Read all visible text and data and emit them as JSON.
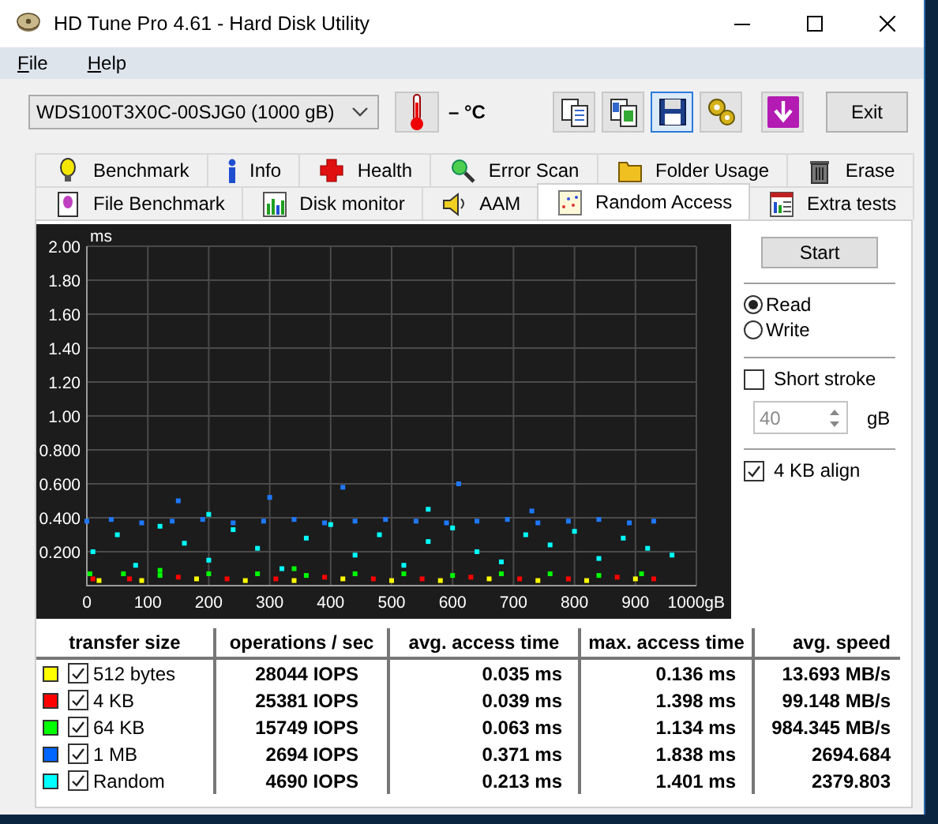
{
  "window": {
    "title": "HD Tune Pro 4.61 - Hard Disk Utility"
  },
  "menu": [
    {
      "label": "File"
    },
    {
      "label": "Help"
    }
  ],
  "toolbar": {
    "drive": "WDS100T3X0C-00SJG0 (1000 gB)",
    "temperature": "– °C",
    "tools": [
      {
        "kind": "copy",
        "selected": false
      },
      {
        "kind": "copy-screen",
        "selected": false
      },
      {
        "kind": "save",
        "selected": true
      },
      {
        "kind": "options",
        "selected": false
      },
      {
        "kind": "update",
        "selected": false
      }
    ],
    "exit": "Exit"
  },
  "tabs": [
    [
      {
        "label": "Benchmark",
        "kind": "bulb",
        "selected": false
      },
      {
        "label": "Info",
        "kind": "info",
        "selected": false
      },
      {
        "label": "Health",
        "kind": "cross",
        "selected": false
      },
      {
        "label": "Error Scan",
        "kind": "magnifier",
        "selected": false
      },
      {
        "label": "Folder Usage",
        "kind": "folder",
        "selected": false
      },
      {
        "label": "Erase",
        "kind": "bin",
        "selected": false
      }
    ],
    [
      {
        "label": "File Benchmark",
        "kind": "file",
        "selected": false
      },
      {
        "label": "Disk monitor",
        "kind": "bars",
        "selected": false
      },
      {
        "label": "AAM",
        "kind": "speaker",
        "selected": false
      },
      {
        "label": "Random Access",
        "kind": "scatter",
        "selected": true
      },
      {
        "label": "Extra tests",
        "kind": "grid",
        "selected": false
      }
    ]
  ],
  "chart_data": {
    "type": "scatter",
    "grid": true,
    "ylabel": "ms",
    "xlim": [
      0,
      1000
    ],
    "ylim": [
      0,
      2
    ],
    "xticks": [
      {
        "value": 0,
        "label": "0"
      },
      {
        "value": 100,
        "label": "100"
      },
      {
        "value": 200,
        "label": "200"
      },
      {
        "value": 300,
        "label": "300"
      },
      {
        "value": 400,
        "label": "400"
      },
      {
        "value": 500,
        "label": "500"
      },
      {
        "value": 600,
        "label": "600"
      },
      {
        "value": 700,
        "label": "700"
      },
      {
        "value": 800,
        "label": "800"
      },
      {
        "value": 900,
        "label": "900"
      },
      {
        "value": 1000,
        "label": "1000gB"
      }
    ],
    "yticks": [
      {
        "value": 0.2,
        "label": "0.200"
      },
      {
        "value": 0.4,
        "label": "0.400"
      },
      {
        "value": 0.6,
        "label": "0.600"
      },
      {
        "value": 0.8,
        "label": "0.800"
      },
      {
        "value": 1.0,
        "label": "1.00"
      },
      {
        "value": 1.2,
        "label": "1.20"
      },
      {
        "value": 1.4,
        "label": "1.40"
      },
      {
        "value": 1.6,
        "label": "1.60"
      },
      {
        "value": 1.8,
        "label": "1.80"
      },
      {
        "value": 2.0,
        "label": "2.00"
      }
    ],
    "series": [
      {
        "color": "#ffff00",
        "x": [
          20,
          90,
          180,
          260,
          340,
          420,
          500,
          580,
          660,
          740,
          820,
          900
        ],
        "values": [
          0.03,
          0.03,
          0.04,
          0.03,
          0.03,
          0.04,
          0.03,
          0.03,
          0.04,
          0.03,
          0.03,
          0.04
        ]
      },
      {
        "color": "#ff0000",
        "x": [
          10,
          70,
          150,
          230,
          310,
          390,
          470,
          550,
          630,
          710,
          790,
          870,
          930
        ],
        "values": [
          0.04,
          0.04,
          0.05,
          0.04,
          0.04,
          0.05,
          0.04,
          0.04,
          0.05,
          0.04,
          0.04,
          0.05,
          0.04
        ]
      },
      {
        "color": "#00ff00",
        "x": [
          5,
          60,
          120,
          200,
          280,
          360,
          440,
          520,
          600,
          680,
          760,
          840,
          910,
          120,
          340
        ],
        "values": [
          0.07,
          0.07,
          0.06,
          0.07,
          0.07,
          0.06,
          0.07,
          0.07,
          0.06,
          0.07,
          0.07,
          0.06,
          0.07,
          0.09,
          0.1
        ]
      },
      {
        "color": "#1e78ff",
        "x": [
          0,
          40,
          90,
          140,
          190,
          240,
          290,
          340,
          390,
          440,
          490,
          540,
          590,
          640,
          690,
          740,
          790,
          840,
          890,
          930,
          150,
          420,
          610,
          300,
          730
        ],
        "values": [
          0.38,
          0.39,
          0.37,
          0.38,
          0.39,
          0.37,
          0.38,
          0.39,
          0.37,
          0.38,
          0.39,
          0.38,
          0.37,
          0.38,
          0.39,
          0.37,
          0.38,
          0.39,
          0.37,
          0.38,
          0.5,
          0.58,
          0.6,
          0.52,
          0.44
        ]
      },
      {
        "color": "#00ffff",
        "x": [
          10,
          50,
          80,
          120,
          160,
          200,
          240,
          280,
          320,
          360,
          400,
          440,
          480,
          520,
          560,
          600,
          640,
          680,
          720,
          760,
          800,
          840,
          880,
          920,
          960,
          200,
          560
        ],
        "values": [
          0.2,
          0.3,
          0.12,
          0.35,
          0.25,
          0.15,
          0.33,
          0.22,
          0.1,
          0.28,
          0.36,
          0.18,
          0.3,
          0.12,
          0.26,
          0.34,
          0.2,
          0.14,
          0.3,
          0.24,
          0.32,
          0.16,
          0.28,
          0.22,
          0.18,
          0.42,
          0.45
        ]
      }
    ]
  },
  "table": {
    "columns": [
      "transfer size",
      "operations / sec",
      "avg. access time",
      "max. access time",
      "avg. speed"
    ],
    "rows": [
      {
        "color": "#ffff00",
        "checked": true,
        "cells": [
          "512 bytes",
          "28044 IOPS",
          "0.035 ms",
          "0.136 ms",
          "13.693 MB/s"
        ]
      },
      {
        "color": "#ff0000",
        "checked": true,
        "cells": [
          "4 KB",
          "25381 IOPS",
          "0.039 ms",
          "1.398 ms",
          "99.148 MB/s"
        ]
      },
      {
        "color": "#00ff00",
        "checked": true,
        "cells": [
          "64 KB",
          "15749 IOPS",
          "0.063 ms",
          "1.134 ms",
          "984.345 MB/s"
        ]
      },
      {
        "color": "#0066ff",
        "checked": true,
        "cells": [
          "1 MB",
          "2694 IOPS",
          "0.371 ms",
          "1.838 ms",
          "2694.684"
        ]
      },
      {
        "color": "#00ffff",
        "checked": true,
        "cells": [
          "Random",
          "4690 IOPS",
          "0.213 ms",
          "1.401 ms",
          "2379.803"
        ]
      }
    ]
  },
  "controls": {
    "start": "Start",
    "modes": [
      {
        "label": "Read",
        "selected": true
      },
      {
        "label": "Write",
        "selected": false
      }
    ],
    "short_stroke": {
      "label": "Short stroke",
      "checked": false
    },
    "size": {
      "value": "40",
      "disabled": true,
      "unit": "gB"
    },
    "align": {
      "label": "4 KB align",
      "checked": true
    }
  }
}
